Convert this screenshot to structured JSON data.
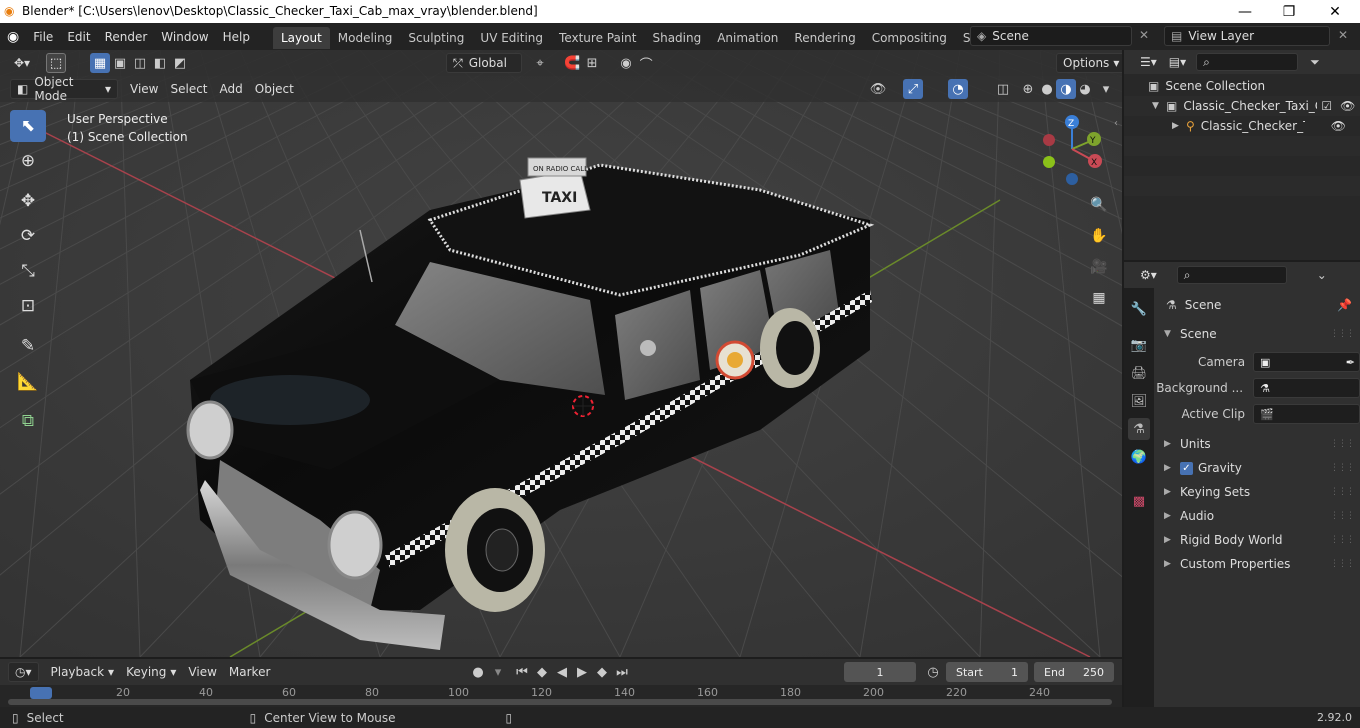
{
  "window": {
    "title": "Blender* [C:\\Users\\lenov\\Desktop\\Classic_Checker_Taxi_Cab_max_vray\\blender.blend]",
    "minimize": "—",
    "maximize": "❐",
    "close": "✕"
  },
  "menu": [
    "File",
    "Edit",
    "Render",
    "Window",
    "Help"
  ],
  "workspaces": [
    "Layout",
    "Modeling",
    "Sculpting",
    "UV Editing",
    "Texture Paint",
    "Shading",
    "Animation",
    "Rendering",
    "Compositing",
    "Scripting"
  ],
  "active_workspace": "Layout",
  "scene_name": "Scene",
  "view_layer": "View Layer",
  "viewport": {
    "mode": "Object Mode",
    "menus": [
      "View",
      "Select",
      "Add",
      "Object"
    ],
    "transform_orientation": "Global",
    "options": "Options",
    "overlay_line1": "User Perspective",
    "overlay_line2": "(1) Scene Collection",
    "gizmo": {
      "z": "Z",
      "y": "Y",
      "x": "X"
    },
    "taxi_sign": "TAXI",
    "taxi_sign_top": "ON RADIO CALL"
  },
  "outliner": {
    "root": "Scene Collection",
    "collection": "Classic_Checker_Taxi_Ca",
    "object": "Classic_Checker_Tax"
  },
  "properties": {
    "header": "Scene",
    "panel": "Scene",
    "fields": [
      {
        "label": "Camera"
      },
      {
        "label": "Background ..."
      },
      {
        "label": "Active Clip"
      }
    ],
    "sections": [
      "Units",
      "Gravity",
      "Keying Sets",
      "Audio",
      "Rigid Body World",
      "Custom Properties"
    ]
  },
  "timeline": {
    "menus": [
      "Playback",
      "Keying",
      "View",
      "Marker"
    ],
    "current_frame": "1",
    "start_label": "Start",
    "start": "1",
    "end_label": "End",
    "end": "250",
    "ticks": [
      "1",
      "20",
      "40",
      "60",
      "80",
      "100",
      "120",
      "140",
      "160",
      "180",
      "200",
      "220",
      "240"
    ]
  },
  "status": {
    "select": "Select",
    "center": "Center View to Mouse",
    "version": "2.92.0"
  },
  "colors": {
    "accent": "#4772b3",
    "axis_x": "#c94a55",
    "axis_y": "#7ea32c",
    "axis_z": "#3a7fd8"
  }
}
